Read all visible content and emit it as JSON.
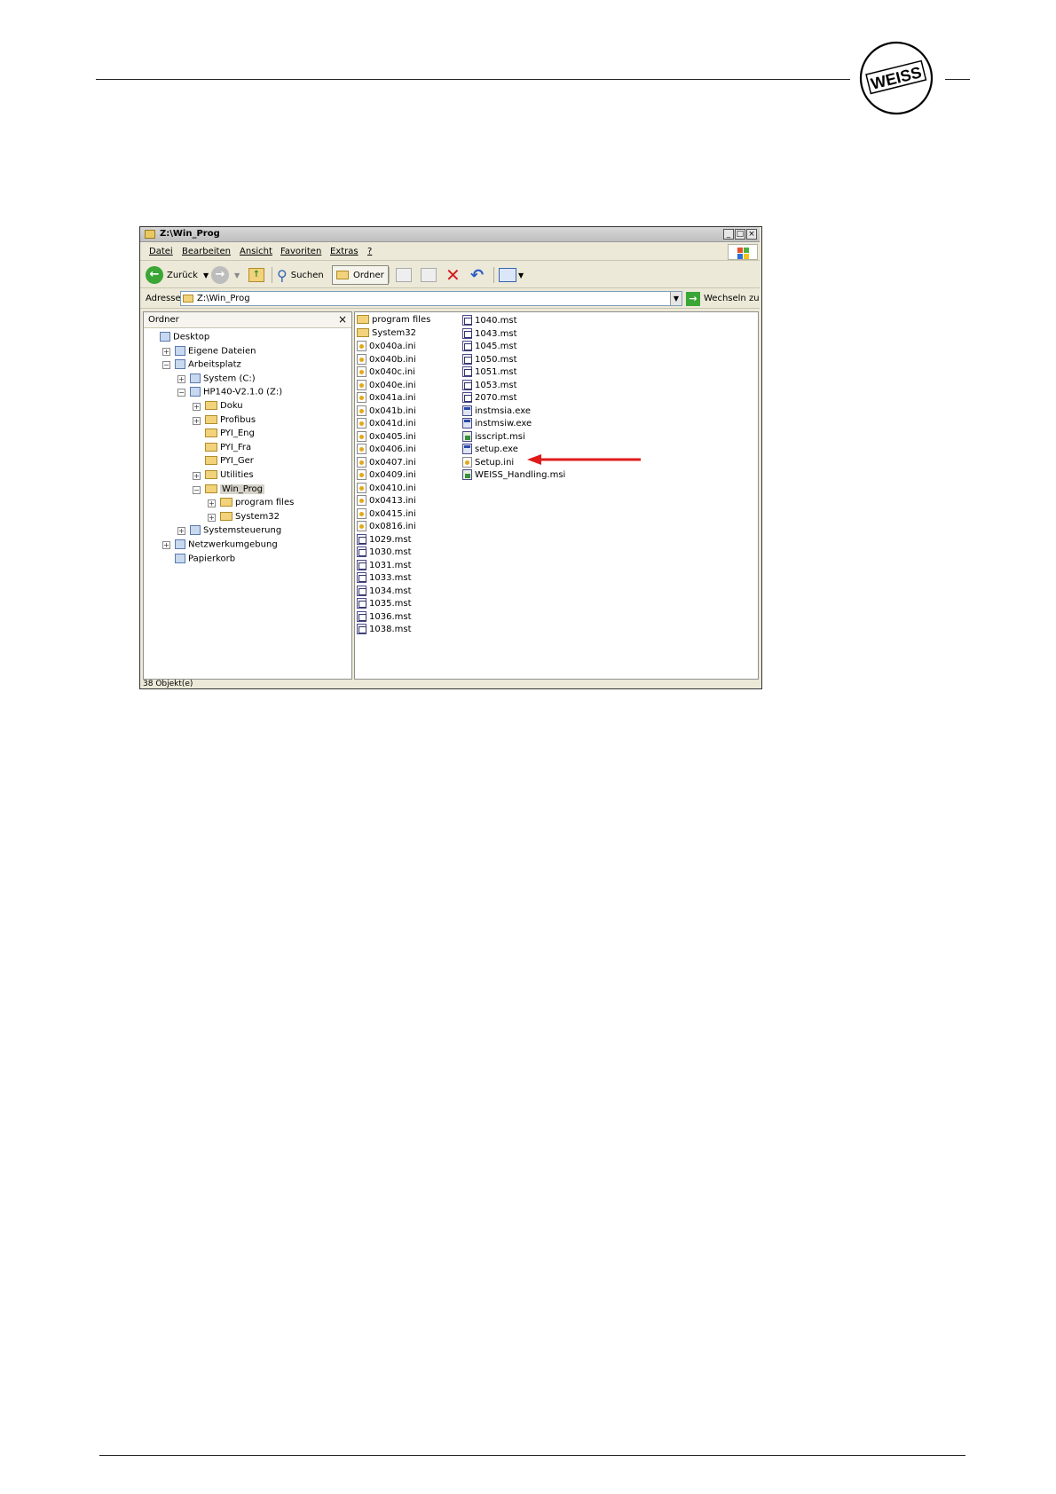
{
  "window": {
    "title": "Z:\\Win_Prog",
    "menu": [
      "Datei",
      "Bearbeiten",
      "Ansicht",
      "Favoriten",
      "Extras",
      "?"
    ],
    "toolbar": {
      "back_label": "Zurück",
      "search_label": "Suchen",
      "folders_label": "Ordner"
    },
    "address": {
      "label": "Adresse",
      "value": "Z:\\Win_Prog",
      "go_label": "Wechseln zu"
    },
    "tree": {
      "header": "Ordner",
      "close": "×",
      "items": [
        {
          "label": "Desktop",
          "level": 0,
          "expander": "",
          "icon": "desktop-icon"
        },
        {
          "label": "Eigene Dateien",
          "level": 1,
          "expander": "+",
          "icon": "my-documents-icon"
        },
        {
          "label": "Arbeitsplatz",
          "level": 1,
          "expander": "−",
          "icon": "my-computer-icon"
        },
        {
          "label": "System (C:)",
          "level": 2,
          "expander": "+",
          "icon": "drive-icon"
        },
        {
          "label": "HP140-V2.1.0 (Z:)",
          "level": 2,
          "expander": "−",
          "icon": "cd-drive-icon"
        },
        {
          "label": "Doku",
          "level": 3,
          "expander": "+",
          "icon": "folder-icon"
        },
        {
          "label": "Profibus",
          "level": 3,
          "expander": "+",
          "icon": "folder-icon"
        },
        {
          "label": "PYI_Eng",
          "level": 3,
          "expander": "",
          "icon": "folder-icon"
        },
        {
          "label": "PYI_Fra",
          "level": 3,
          "expander": "",
          "icon": "folder-icon"
        },
        {
          "label": "PYI_Ger",
          "level": 3,
          "expander": "",
          "icon": "folder-icon"
        },
        {
          "label": "Utilities",
          "level": 3,
          "expander": "+",
          "icon": "folder-icon"
        },
        {
          "label": "Win_Prog",
          "level": 3,
          "expander": "−",
          "icon": "folder-open-icon",
          "selected": true
        },
        {
          "label": "program files",
          "level": 4,
          "expander": "+",
          "icon": "folder-icon"
        },
        {
          "label": "System32",
          "level": 4,
          "expander": "+",
          "icon": "folder-icon"
        },
        {
          "label": "Systemsteuerung",
          "level": 2,
          "expander": "+",
          "icon": "control-panel-icon"
        },
        {
          "label": "Netzwerkumgebung",
          "level": 1,
          "expander": "+",
          "icon": "network-icon"
        },
        {
          "label": "Papierkorb",
          "level": 1,
          "expander": "",
          "icon": "recycle-bin-icon"
        }
      ]
    },
    "files_col1": [
      {
        "name": "program files",
        "type": "folder"
      },
      {
        "name": "System32",
        "type": "folder"
      },
      {
        "name": "0x040a.ini",
        "type": "ini"
      },
      {
        "name": "0x040b.ini",
        "type": "ini"
      },
      {
        "name": "0x040c.ini",
        "type": "ini"
      },
      {
        "name": "0x040e.ini",
        "type": "ini"
      },
      {
        "name": "0x041a.ini",
        "type": "ini"
      },
      {
        "name": "0x041b.ini",
        "type": "ini"
      },
      {
        "name": "0x041d.ini",
        "type": "ini"
      },
      {
        "name": "0x0405.ini",
        "type": "ini"
      },
      {
        "name": "0x0406.ini",
        "type": "ini"
      },
      {
        "name": "0x0407.ini",
        "type": "ini"
      },
      {
        "name": "0x0409.ini",
        "type": "ini"
      },
      {
        "name": "0x0410.ini",
        "type": "ini"
      },
      {
        "name": "0x0413.ini",
        "type": "ini"
      },
      {
        "name": "0x0415.ini",
        "type": "ini"
      },
      {
        "name": "0x0816.ini",
        "type": "ini"
      },
      {
        "name": "1029.mst",
        "type": "mst"
      },
      {
        "name": "1030.mst",
        "type": "mst"
      },
      {
        "name": "1031.mst",
        "type": "mst"
      },
      {
        "name": "1033.mst",
        "type": "mst"
      },
      {
        "name": "1034.mst",
        "type": "mst"
      },
      {
        "name": "1035.mst",
        "type": "mst"
      },
      {
        "name": "1036.mst",
        "type": "mst"
      },
      {
        "name": "1038.mst",
        "type": "mst"
      }
    ],
    "files_col2": [
      {
        "name": "1040.mst",
        "type": "mst"
      },
      {
        "name": "1043.mst",
        "type": "mst"
      },
      {
        "name": "1045.mst",
        "type": "mst"
      },
      {
        "name": "1050.mst",
        "type": "mst"
      },
      {
        "name": "1051.mst",
        "type": "mst"
      },
      {
        "name": "1053.mst",
        "type": "mst"
      },
      {
        "name": "2070.mst",
        "type": "mst"
      },
      {
        "name": "instmsia.exe",
        "type": "exe"
      },
      {
        "name": "instmsiw.exe",
        "type": "exe"
      },
      {
        "name": "isscript.msi",
        "type": "msi"
      },
      {
        "name": "setup.exe",
        "type": "exe",
        "highlighted": true
      },
      {
        "name": "Setup.ini",
        "type": "ini"
      },
      {
        "name": "WEISS_Handling.msi",
        "type": "msi"
      }
    ],
    "status": "38 Objekt(e)"
  },
  "logo": {
    "text": "WEISS"
  },
  "colors": {
    "arrow": "#e01b1b",
    "folder": "#f2d27a",
    "go_green": "#3aa636"
  }
}
